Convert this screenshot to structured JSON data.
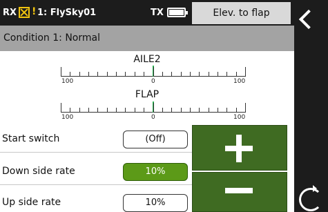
{
  "status": {
    "rx_label": "RX",
    "warn_glyph": "!",
    "model_name": "1: FlySky01",
    "tx_label": "TX",
    "page_title": "Elev. to flap"
  },
  "condition": "Condition 1:  Normal",
  "gauges": [
    {
      "name": "AILE2",
      "value": 0,
      "left_tick": "100",
      "mid_tick": "0",
      "right_tick": "100"
    },
    {
      "name": "FLAP",
      "value": 0,
      "left_tick": "100",
      "mid_tick": "0",
      "right_tick": "100"
    }
  ],
  "settings": {
    "start_switch": {
      "label": "Start switch",
      "value": "(Off)"
    },
    "down_side_rate": {
      "label": "Down side rate",
      "value": "10%"
    },
    "up_side_rate": {
      "label": "Up side rate",
      "value": "10%"
    }
  },
  "icons": {
    "back": "back-chevron-icon",
    "refresh": "refresh-icon",
    "plus": "plus-icon",
    "minus": "minus-icon",
    "rx_error": "rx-error-x-icon",
    "battery": "battery-icon"
  },
  "colors": {
    "bar": "#1c1c1c",
    "condition_bar": "#a3a3a3",
    "selected_value": "#5c9a18",
    "adjust_button": "#3f6b22",
    "gauge_marker": "#22b14c",
    "warning": "#f1c40f"
  }
}
